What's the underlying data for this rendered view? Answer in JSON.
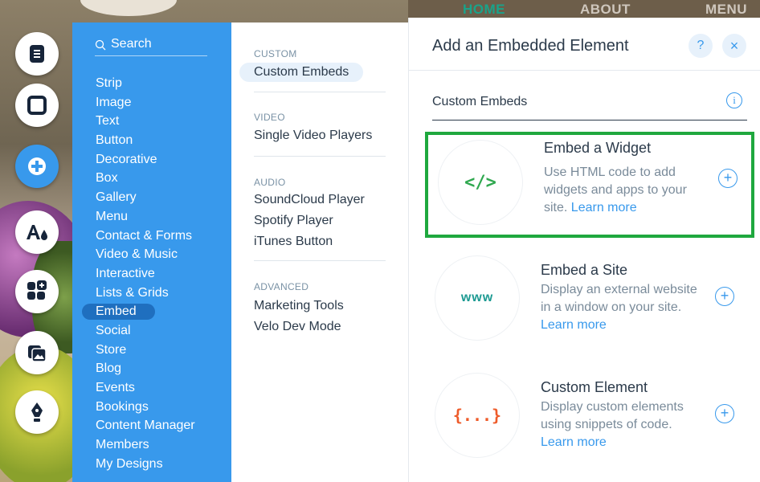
{
  "site_nav": {
    "home": "HOME",
    "about": "ABOUT",
    "menu": "MENU"
  },
  "rail": {
    "buttons": [
      {
        "name": "pages-icon"
      },
      {
        "name": "background-icon"
      },
      {
        "name": "add-icon"
      },
      {
        "name": "theme-icon"
      },
      {
        "name": "app-market-icon"
      },
      {
        "name": "media-icon"
      },
      {
        "name": "blog-pen-icon"
      }
    ]
  },
  "categories": {
    "search_label": "Search",
    "items": [
      "Strip",
      "Image",
      "Text",
      "Button",
      "Decorative",
      "Box",
      "Gallery",
      "Menu",
      "Contact & Forms",
      "Video & Music",
      "Interactive",
      "Lists & Grids",
      "Embed",
      "Social",
      "Store",
      "Blog",
      "Events",
      "Bookings",
      "Content Manager",
      "Members",
      "My Designs"
    ],
    "selected": "Embed"
  },
  "subcategories": {
    "custom_label": "CUSTOM",
    "custom_embeds": "Custom Embeds",
    "video_label": "VIDEO",
    "single_video_players": "Single Video Players",
    "audio_label": "AUDIO",
    "soundcloud": "SoundCloud Player",
    "spotify": "Spotify Player",
    "itunes": "iTunes Button",
    "advanced_label": "ADVANCED",
    "marketing_tools": "Marketing Tools",
    "velo": "Velo Dev Mode"
  },
  "panel": {
    "title": "Add an Embedded Element",
    "help": "?",
    "close": "×",
    "group_title": "Custom Embeds",
    "info": "i",
    "cards": [
      {
        "icon_text": "</>",
        "icon_color": "#2fa84f",
        "title": "Embed a Widget",
        "desc": "Use HTML code to add widgets and apps to your site.",
        "link": "Learn more"
      },
      {
        "icon_text": "www",
        "icon_color": "#1c9a92",
        "title": "Embed a Site",
        "desc": "Display an external website in a window on your site.",
        "link": "Learn more"
      },
      {
        "icon_text": "{...}",
        "icon_color": "#ee5b2a",
        "title": "Custom Element",
        "desc": "Display custom elements using snippets of code.",
        "link": "Learn more"
      }
    ],
    "add": "+"
  },
  "colors": {
    "accent": "#3899ec",
    "highlight": "#1fa83e"
  }
}
